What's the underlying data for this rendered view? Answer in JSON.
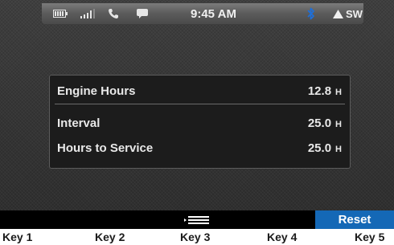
{
  "status_bar": {
    "icons": [
      "battery-icon",
      "signal-icon",
      "phone-icon",
      "message-icon",
      "bluetooth-icon",
      "compass-arrow-icon"
    ],
    "time": "9:45 AM",
    "heading": "SW",
    "bluetooth_color": "#1e6fd9"
  },
  "info_panel": {
    "rows": [
      {
        "label": "Engine Hours",
        "value": "12.8",
        "unit": "H"
      },
      {
        "label": "Interval",
        "value": "25.0",
        "unit": "H"
      },
      {
        "label": "Hours to Service",
        "value": "25.0",
        "unit": "H"
      }
    ]
  },
  "softkeys": {
    "key3_icon": "menu-icon",
    "key5_label": "Reset",
    "key5_color": "#1468b6"
  },
  "key_labels": [
    "Key 1",
    "Key 2",
    "Key 3",
    "Key 4",
    "Key 5"
  ]
}
